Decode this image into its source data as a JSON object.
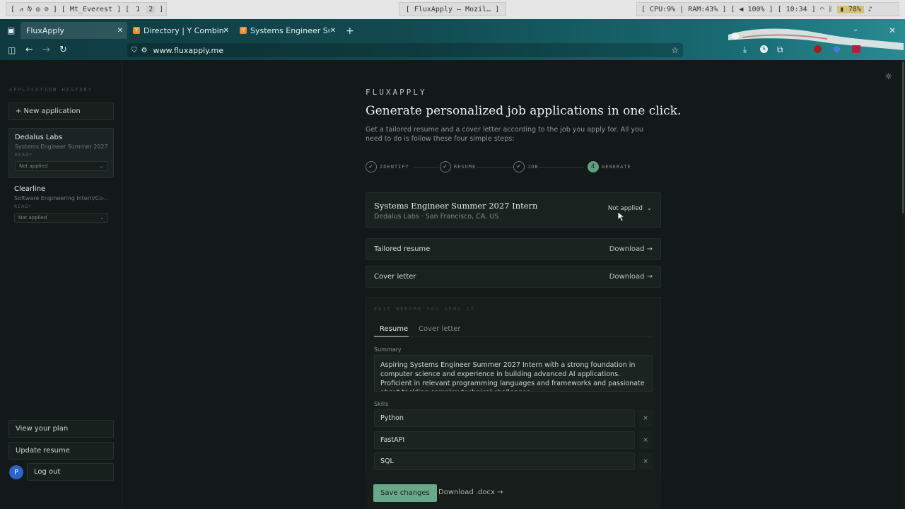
{
  "sysbar": {
    "left_icons": "[ ⩘ ⍉ ◎ ⊘ ]",
    "workspace_name": "Mt_Everest",
    "workspaces": [
      "1",
      "2"
    ],
    "window_title": "[ FluxApply — Mozil… ]",
    "cpu": "CPU:9%",
    "ram": "RAM:43%",
    "volume": "100%",
    "time": "10:34",
    "battery": "78%"
  },
  "browser": {
    "tabs": [
      {
        "label": "FluxApply",
        "active": true
      },
      {
        "label": "Directory | Y Combinato",
        "active": false
      },
      {
        "label": "Systems Engineer Summ",
        "active": false
      }
    ],
    "new_tab": "+",
    "url": "www.fluxapply.me"
  },
  "sidebar": {
    "title": "APPLICATION HISTORY",
    "new_button": "+ New application",
    "applications": [
      {
        "company": "Dedalus Labs",
        "role": "Systems Engineer Summer 2027...",
        "status": "READY",
        "applied": "Not applied",
        "selected": true
      },
      {
        "company": "Clearline",
        "role": "Software Engineering Intern/Co-...",
        "status": "READY",
        "applied": "Not applied",
        "selected": false
      }
    ],
    "view_plan": "View your plan",
    "update_resume": "Update resume",
    "avatar_initial": "P",
    "logout": "Log out"
  },
  "main": {
    "brand": "FLUXAPPLY",
    "headline": "Generate personalized job applications in one click.",
    "lead": "Get a tailored resume and a cover letter according to the job you apply for. All you need to do is follow these four simple steps:",
    "steps": [
      {
        "icon": "✓",
        "label": "IDENTIFY"
      },
      {
        "icon": "✓",
        "label": "RESUME"
      },
      {
        "icon": "✓",
        "label": "JOB"
      },
      {
        "icon": "4",
        "label": "GENERATE"
      }
    ],
    "job": {
      "title": "Systems Engineer Summer 2027 Intern",
      "meta": "Dedalus Labs · San Francisco, CA, US",
      "status": "Not applied"
    },
    "downloads": [
      {
        "label": "Tailored resume",
        "action": "Download →"
      },
      {
        "label": "Cover letter",
        "action": "Download →"
      }
    ],
    "edit": {
      "title": "EDIT BEFORE YOU SEND IT",
      "tabs": [
        "Resume",
        "Cover letter"
      ],
      "summary_label": "Summary",
      "summary": "Aspiring Systems Engineer Summer 2027 Intern with a strong foundation in computer science and experience in building advanced AI applications. Proficient in relevant programming languages and frameworks and passionate about tackling complex technical challenges.",
      "skills_label": "Skills",
      "skills": [
        "Python",
        "FastAPI",
        "SQL"
      ],
      "remove_glyph": "×",
      "save": "Save changes",
      "download_docx": "Download .docx →"
    }
  },
  "colors": {
    "accent": "#6aa88b",
    "background": "#131918",
    "card": "#1a2220"
  }
}
